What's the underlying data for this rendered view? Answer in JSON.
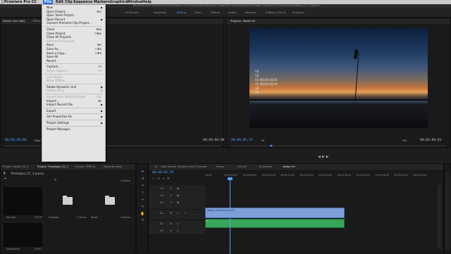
{
  "menubar": {
    "app": "Premiere Pro CC",
    "items": [
      "File",
      "Edit",
      "Clip",
      "Sequence",
      "Markers",
      "Graphics",
      "Window",
      "Help"
    ]
  },
  "title": "Volumes/LACIE SHARE/PP/UCB/Dynamic Link Demos/Work/Sample Projects/03 Project Panel/03 Adobe Premiere Pro Projects/Timelapse_CC_1.prproj *",
  "workspaces": {
    "tabs": [
      "All Panels",
      "Assembly",
      "Editing",
      "Color",
      "Effects",
      "Audio",
      "Libraries",
      "Editing (CS5.5)",
      "Graphics"
    ],
    "active": "Editing"
  },
  "file_menu": {
    "items": [
      {
        "label": "New",
        "submenu": true
      },
      {
        "label": "Open Project...",
        "shortcut": "⌘O"
      },
      {
        "label": "Open Team Project..."
      },
      {
        "label": "Open Recent",
        "submenu": true
      },
      {
        "label": "Convert Premiere Clip Project..."
      },
      {
        "sep": true
      },
      {
        "label": "Close",
        "shortcut": "⌘W"
      },
      {
        "label": "Close Project",
        "shortcut": "⇧⌘W"
      },
      {
        "label": "Close All Projects"
      },
      {
        "label": "Refresh All Projects",
        "disabled": true
      },
      {
        "label": "Save",
        "shortcut": "⌘S"
      },
      {
        "label": "Save As...",
        "shortcut": "⇧⌘S"
      },
      {
        "label": "Save a Copy...",
        "shortcut": "⌥⌘S"
      },
      {
        "label": "Save All"
      },
      {
        "label": "Revert"
      },
      {
        "sep": true
      },
      {
        "label": "Capture...",
        "shortcut": "F5"
      },
      {
        "label": "Batch Capture...",
        "shortcut": "F6",
        "disabled": true
      },
      {
        "sep": true
      },
      {
        "label": "Link Media...",
        "disabled": true
      },
      {
        "label": "Make Offline...",
        "disabled": true
      },
      {
        "sep": true
      },
      {
        "label": "Adobe Dynamic Link",
        "submenu": true
      },
      {
        "label": "Adobe Story",
        "submenu": true,
        "disabled": true
      },
      {
        "sep": true
      },
      {
        "label": "Import from Media Browser",
        "shortcut": "⌥⌘I",
        "disabled": true
      },
      {
        "label": "Import...",
        "shortcut": "⌘I"
      },
      {
        "label": "Import Recent File",
        "submenu": true
      },
      {
        "sep": true
      },
      {
        "label": "Export",
        "submenu": true
      },
      {
        "sep": true
      },
      {
        "label": "Get Properties for",
        "submenu": true
      },
      {
        "sep": true
      },
      {
        "label": "Project Settings",
        "submenu": true
      },
      {
        "sep": true
      },
      {
        "label": "Project Manager..."
      }
    ]
  },
  "source_panel": {
    "tabs": [
      "Source: (no clips)",
      "Effect C"
    ],
    "timecode": "00;00;00;00",
    "page_label": "Page",
    "timecode_right": "00;00;00;00"
  },
  "program_monitor": {
    "title": "Program: Abobo 9G",
    "overlay_lines": [
      "V3",
      "V2",
      "V1 00;05;58;16",
      "A1 00;05;58;16",
      "A2",
      "A3"
    ],
    "timecode": "00;00;05;19",
    "fit": "Fit",
    "zoom": "Full",
    "timecode_right": "00;06;00;01"
  },
  "project_panel": {
    "tabs": [
      "Project: Abobo_CC_1",
      "Project: Timelapse_CC_1",
      "Project: PPRF18",
      "Media Browser"
    ],
    "project_file": "Timelapse_CC_1.prproj",
    "item_count": "4 Items",
    "items": [
      {
        "name": "Ssl Aon",
        "meta": "53;19"
      },
      {
        "name": "Footage",
        "meta": "2 Items"
      },
      {
        "name": "Music",
        "meta": "2 Items"
      },
      {
        "name": "Stills",
        "meta": "2 Items"
      },
      {
        "name": "Southwest",
        "meta": "53;07"
      }
    ]
  },
  "timeline": {
    "tabs": [
      "10",
      "New Search Options in the Timeline",
      "Promo",
      "3rd Act",
      "Southwest",
      "Abobo 9G"
    ],
    "active_tab": "Abobo 9G",
    "timecode": "00;00;05;19",
    "ruler": [
      "00;00",
      "00;00;04;00",
      "00;00;08;00",
      "00;00;12;00",
      "00;00;16;00",
      "00;00;20;00",
      "00;00;24;00",
      "00;00;28;00",
      "00;00;32;00",
      "00;00;36;00",
      "00;00;40;00",
      "00;00;44;00"
    ],
    "video_tracks": [
      "V3",
      "V2",
      "V1"
    ],
    "audio_tracks": [
      "A1",
      "A2",
      "A3"
    ],
    "video_clip": "Abobo_Sunset.mov [V]",
    "audio_clip_label": "fx"
  },
  "tools": [
    "selection-tool",
    "track-select-tool",
    "ripple-edit-tool",
    "razor-tool",
    "slip-tool",
    "pen-tool",
    "hand-tool",
    "type-tool"
  ]
}
